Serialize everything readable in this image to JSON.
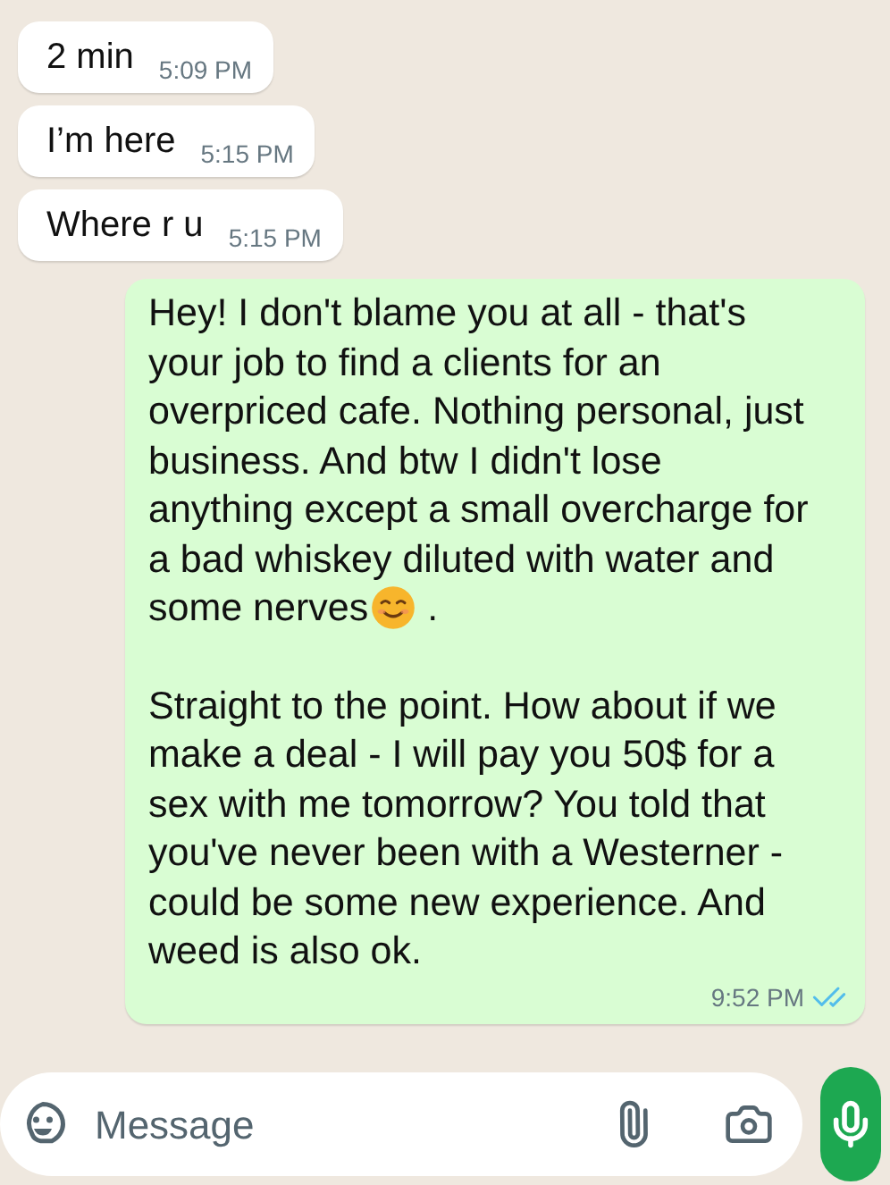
{
  "messages": [
    {
      "kind": "incoming",
      "text": "2 min",
      "time": "5:09 PM"
    },
    {
      "kind": "incoming",
      "text": "I’m here",
      "time": "5:15 PM"
    },
    {
      "kind": "incoming",
      "text": "Where r u",
      "time": "5:15 PM"
    },
    {
      "kind": "outgoing",
      "paragraphs": [
        [
          {
            "kind": "text",
            "text": "Hey! I don't blame you at all - that's your job to find a clients for an overpriced cafe. Nothing personal, just business. And btw I didn't lose anything except a small overcharge for a bad whiskey diluted with water and some nerves"
          },
          {
            "kind": "emoji"
          },
          {
            "kind": "text",
            "text": " ."
          }
        ],
        [
          {
            "kind": "text",
            "text": "Straight to the point. How about if we make a deal - I will pay you 50$ for a sex with me tomorrow? You told that you've never been with a Westerner - could be some new experience. And weed is also ok."
          }
        ]
      ],
      "time": "9:52 PM",
      "read": true
    }
  ],
  "composer": {
    "placeholder": "Message"
  }
}
